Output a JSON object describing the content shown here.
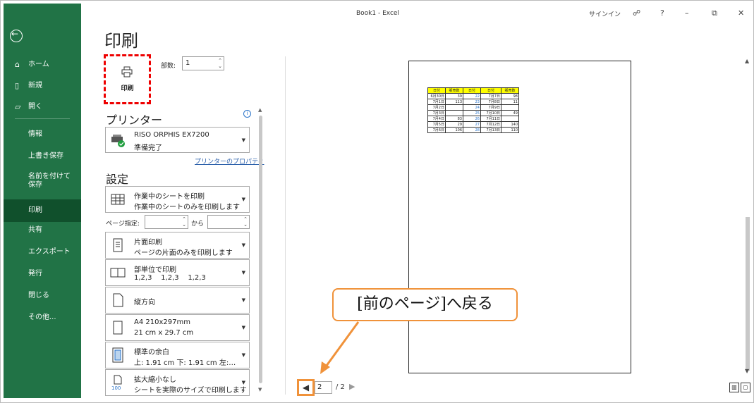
{
  "window": {
    "title": "Book1 - Excel",
    "signin": "サインイン",
    "help": "?",
    "minimize": "–",
    "restore": "⧉",
    "close": "✕"
  },
  "nav": {
    "items": [
      {
        "label": "ホーム",
        "icon": "home-icon"
      },
      {
        "label": "新規",
        "icon": "new-file-icon"
      },
      {
        "label": "開く",
        "icon": "folder-open-icon"
      },
      {
        "label": "情報"
      },
      {
        "label": "上書き保存"
      },
      {
        "label": "名前を付けて保存"
      },
      {
        "label": "印刷"
      },
      {
        "label": "共有"
      },
      {
        "label": "エクスポート"
      },
      {
        "label": "発行"
      },
      {
        "label": "閉じる"
      },
      {
        "label": "その他..."
      }
    ],
    "active_index": 6
  },
  "page_title": "印刷",
  "print_button": {
    "label": "印刷"
  },
  "copies": {
    "label": "部数:",
    "value": "1"
  },
  "printer": {
    "heading": "プリンター",
    "name": "RISO ORPHIS EX7200",
    "status": "準備完了",
    "properties_link": "プリンターのプロパティ"
  },
  "settings": {
    "heading": "設定",
    "what": {
      "t1": "作業中のシートを印刷",
      "t2": "作業中のシートのみを印刷します"
    },
    "pages_label": "ページ指定:",
    "pages_to": "から",
    "sides": {
      "t1": "片面印刷",
      "t2": "ページの片面のみを印刷します"
    },
    "collate": {
      "t1": "部単位で印刷",
      "t2": "1,2,3    1,2,3    1,2,3"
    },
    "orientation": {
      "t1": "縦方向"
    },
    "paper": {
      "t1": "A4 210x297mm",
      "t2": "21 cm x 29.7 cm"
    },
    "margins": {
      "t1": "標準の余白",
      "t2": "上: 1.91 cm 下: 1.91 cm 左:…"
    },
    "scaling": {
      "t1": "拡大縮小なし",
      "t2": "シートを実際のサイズで印刷します"
    }
  },
  "preview": {
    "table": {
      "headers": [
        "日付",
        "販売数",
        "日付",
        "日付",
        "販売数"
      ],
      "rows": [
        [
          "6月30日",
          "39",
          "22",
          "7月7日",
          "98"
        ],
        [
          "7月1日",
          "113",
          "23",
          "7月8日",
          "11"
        ],
        [
          "7月2日",
          "",
          "24",
          "7月9日",
          ""
        ],
        [
          "7月3日",
          "",
          "25",
          "7月10日",
          "49"
        ],
        [
          "7月4日",
          "83",
          "26",
          "7月11日",
          ""
        ],
        [
          "7月5日",
          "29",
          "27",
          "7月12日",
          "140"
        ],
        [
          "7月6日",
          "106",
          "28",
          "7月13日",
          "110"
        ]
      ]
    },
    "current_page": "2",
    "total_pages": "/ 2"
  },
  "callout": "[前のページ]へ戻る"
}
